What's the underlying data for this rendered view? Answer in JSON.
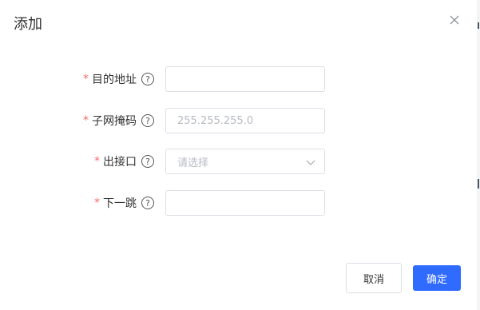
{
  "dialog": {
    "title": "添加",
    "close_icon": "close-icon"
  },
  "form": {
    "required_mark": "*",
    "help_glyph": "?",
    "fields": [
      {
        "label": "目的地址",
        "value": "",
        "placeholder": ""
      },
      {
        "label": "子网掩码",
        "value": "",
        "placeholder": "255.255.255.0"
      },
      {
        "label": "出接口",
        "selected": "请选择"
      },
      {
        "label": "下一跳",
        "value": "",
        "placeholder": ""
      }
    ]
  },
  "buttons": {
    "cancel_label": "取消",
    "confirm_label": "确定"
  },
  "colors": {
    "primary": "#2f6bff",
    "required": "#f56c6c",
    "border": "#dcdfe6",
    "placeholder": "#b8bcc4"
  }
}
